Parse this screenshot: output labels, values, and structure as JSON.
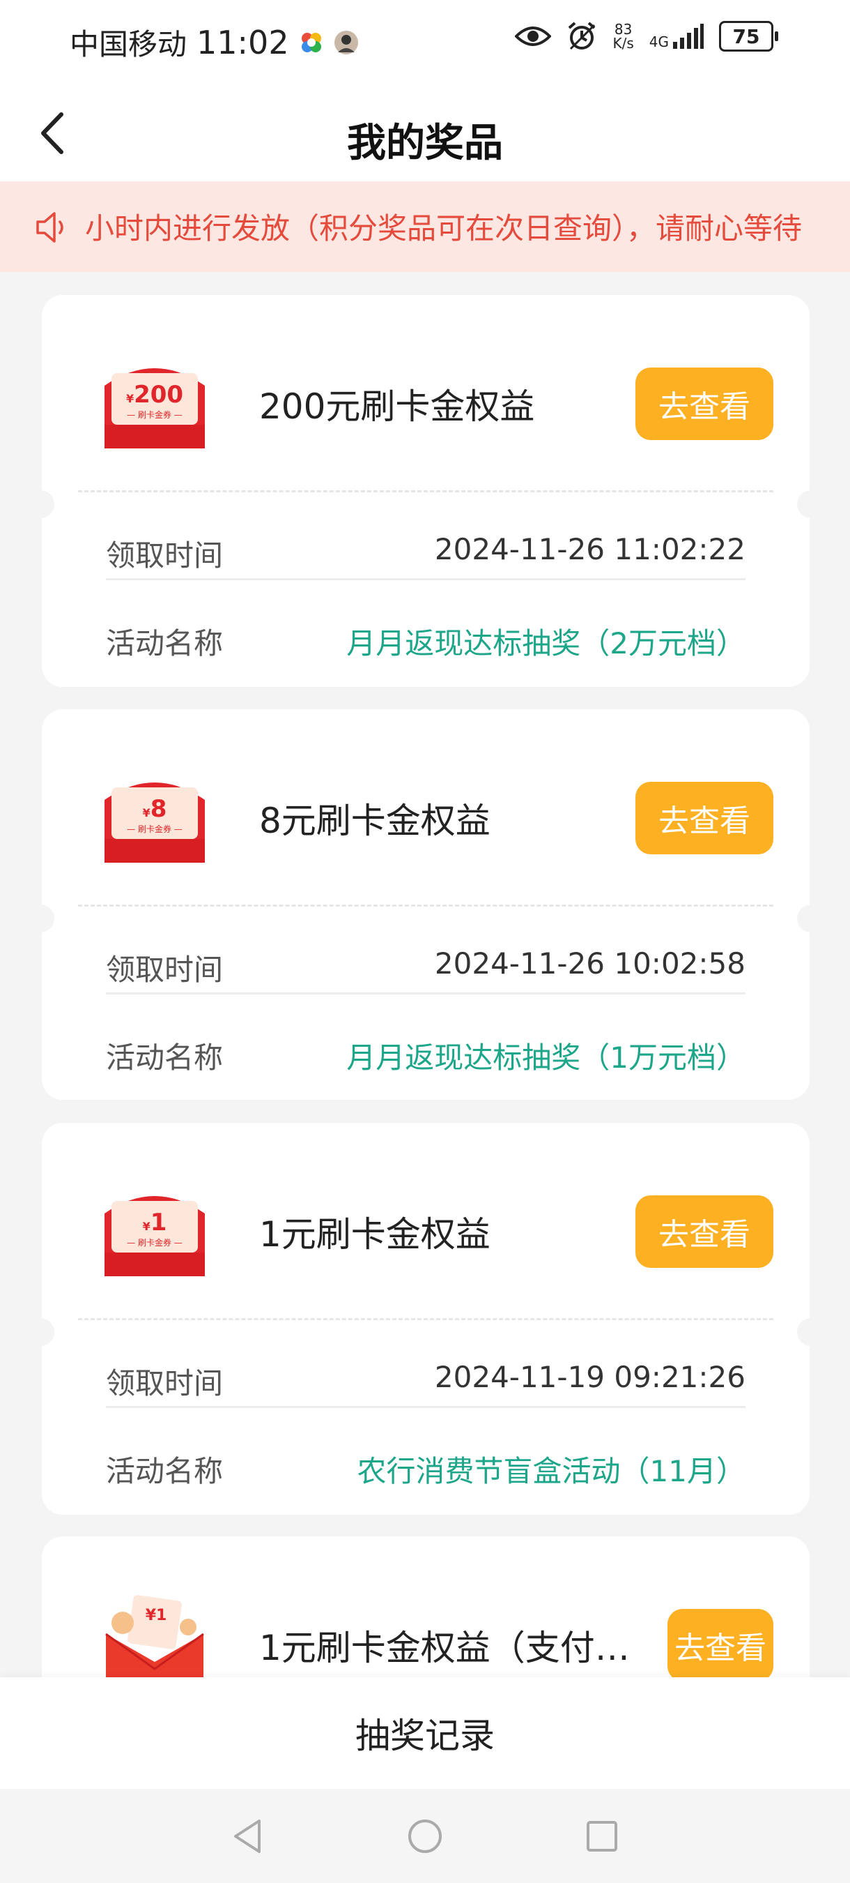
{
  "status_bar": {
    "carrier": "中国移动",
    "time": "11:02",
    "net_speed_value": "83",
    "net_speed_unit": "K/s",
    "network_type": "4G",
    "battery": "75"
  },
  "header": {
    "title": "我的奖品"
  },
  "notice": {
    "text": "小时内进行发放（积分奖品可在次日查询），请耐心等待"
  },
  "labels": {
    "claim_time": "领取时间",
    "activity_name": "活动名称",
    "view_button": "去查看"
  },
  "prizes": [
    {
      "coupon_amount": "200",
      "coupon_symbol": "¥",
      "coupon_caption": "— 刷卡金券 —",
      "title": "200元刷卡金权益",
      "claim_time": "2024-11-26 11:02:22",
      "activity": "月月返现达标抽奖（2万元档）"
    },
    {
      "coupon_amount": "8",
      "coupon_symbol": "¥",
      "coupon_caption": "— 刷卡金券 —",
      "title": "8元刷卡金权益",
      "claim_time": "2024-11-26 10:02:58",
      "activity": "月月返现达标抽奖（1万元档）"
    },
    {
      "coupon_amount": "1",
      "coupon_symbol": "¥",
      "coupon_caption": "— 刷卡金券 —",
      "title": "1元刷卡金权益",
      "claim_time": "2024-11-19 09:21:26",
      "activity": "农行消费节盲盒活动（11月）"
    },
    {
      "coupon_amount": "¥1",
      "title": "1元刷卡金权益（支付…"
    }
  ],
  "bottom": {
    "lottery_record": "抽奖记录"
  },
  "colors": {
    "accent": "#fdb022",
    "green": "#1ea68a",
    "notice_bg": "#fde7e2",
    "notice_text": "#e44b3c",
    "coupon_red": "#e0262a"
  },
  "icons": [
    "back-arrow-icon",
    "speaker-icon",
    "eye-icon",
    "alarm-icon",
    "signal-icon",
    "battery-icon",
    "nav-back-icon",
    "nav-home-icon",
    "nav-recents-icon"
  ]
}
